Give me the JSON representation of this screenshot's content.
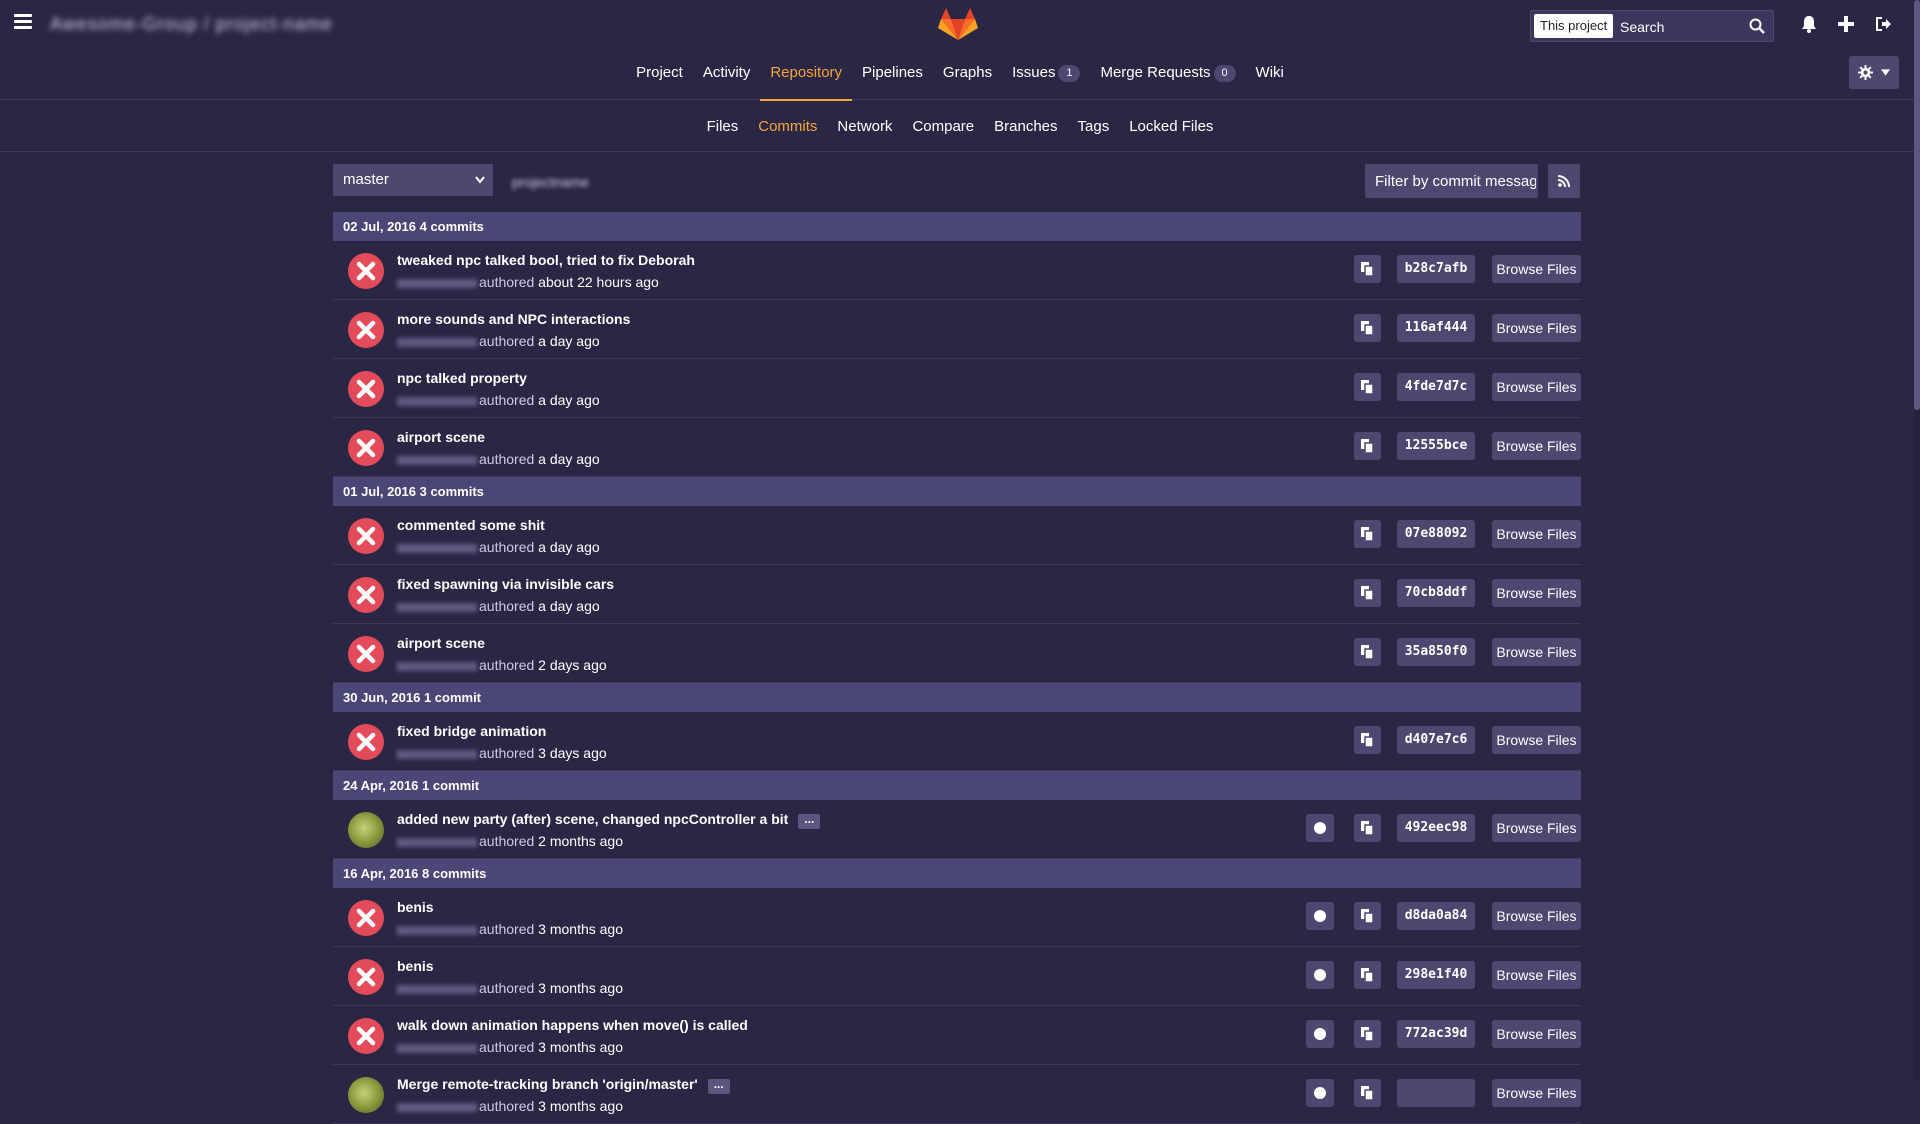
{
  "header": {
    "project_title": "Awesome-Group / project-name",
    "search_scope": "This project",
    "search_placeholder": "Search"
  },
  "main_nav": [
    {
      "label": "Project",
      "active": false
    },
    {
      "label": "Activity",
      "active": false
    },
    {
      "label": "Repository",
      "active": true
    },
    {
      "label": "Pipelines",
      "active": false
    },
    {
      "label": "Graphs",
      "active": false
    },
    {
      "label": "Issues",
      "active": false,
      "count": "1"
    },
    {
      "label": "Merge Requests",
      "active": false,
      "count": "0"
    },
    {
      "label": "Wiki",
      "active": false
    }
  ],
  "sub_nav": [
    {
      "label": "Files",
      "active": false
    },
    {
      "label": "Commits",
      "active": true
    },
    {
      "label": "Network",
      "active": false
    },
    {
      "label": "Compare",
      "active": false
    },
    {
      "label": "Branches",
      "active": false
    },
    {
      "label": "Tags",
      "active": false
    },
    {
      "label": "Locked Files",
      "active": false
    }
  ],
  "filters": {
    "branch": "master",
    "path": "projectname",
    "filter_placeholder": "Filter by commit message"
  },
  "commit_groups": [
    {
      "header": "02 Jul, 2016 4 commits",
      "commits": [
        {
          "title": "tweaked npc talked bool, tried to fix Deborah",
          "authored": "authored",
          "time": "about 22 hours ago",
          "sha": "b28c7afb",
          "avatar": "fail",
          "status": false,
          "more": false
        },
        {
          "title": "more sounds and NPC interactions",
          "authored": "authored",
          "time": "a day ago",
          "sha": "116af444",
          "avatar": "fail",
          "status": false,
          "more": false
        },
        {
          "title": "npc talked property",
          "authored": "authored",
          "time": "a day ago",
          "sha": "4fde7d7c",
          "avatar": "fail",
          "status": false,
          "more": false
        },
        {
          "title": "airport scene",
          "authored": "authored",
          "time": "a day ago",
          "sha": "12555bce",
          "avatar": "fail",
          "status": false,
          "more": false
        }
      ]
    },
    {
      "header": "01 Jul, 2016 3 commits",
      "commits": [
        {
          "title": "commented some shit",
          "authored": "authored",
          "time": "a day ago",
          "sha": "07e88092",
          "avatar": "fail",
          "status": false,
          "more": false
        },
        {
          "title": "fixed spawning via invisible cars",
          "authored": "authored",
          "time": "a day ago",
          "sha": "70cb8ddf",
          "avatar": "fail",
          "status": false,
          "more": false
        },
        {
          "title": "airport scene",
          "authored": "authored",
          "time": "2 days ago",
          "sha": "35a850f0",
          "avatar": "fail",
          "status": false,
          "more": false
        }
      ]
    },
    {
      "header": "30 Jun, 2016 1 commit",
      "commits": [
        {
          "title": "fixed bridge animation",
          "authored": "authored",
          "time": "3 days ago",
          "sha": "d407e7c6",
          "avatar": "fail",
          "status": false,
          "more": false
        }
      ]
    },
    {
      "header": "24 Apr, 2016 1 commit",
      "commits": [
        {
          "title": "added new party (after) scene, changed npcController a bit",
          "authored": "authored",
          "time": "2 months ago",
          "sha": "492eec98",
          "avatar": "frog",
          "status": true,
          "more": true
        }
      ]
    },
    {
      "header": "16 Apr, 2016 8 commits",
      "commits": [
        {
          "title": "benis",
          "authored": "authored",
          "time": "3 months ago",
          "sha": "d8da0a84",
          "avatar": "fail",
          "status": true,
          "more": false
        },
        {
          "title": "benis",
          "authored": "authored",
          "time": "3 months ago",
          "sha": "298e1f40",
          "avatar": "fail",
          "status": true,
          "more": false
        },
        {
          "title": "walk down animation happens when move() is called",
          "authored": "authored",
          "time": "3 months ago",
          "sha": "772ac39d",
          "avatar": "fail",
          "status": true,
          "more": false
        },
        {
          "title": "Merge remote-tracking branch 'origin/master'",
          "authored": "authored",
          "time": "3 months ago",
          "sha": "",
          "avatar": "frog",
          "status": true,
          "more": true
        }
      ]
    }
  ],
  "labels": {
    "browse_files": "Browse Files",
    "more": "..."
  },
  "colors": {
    "background": "#2a2745",
    "accent": "#f6a33c",
    "button": "#4c4870",
    "day_header": "#4a4676",
    "pipeline_failed": "#e34b5a"
  }
}
